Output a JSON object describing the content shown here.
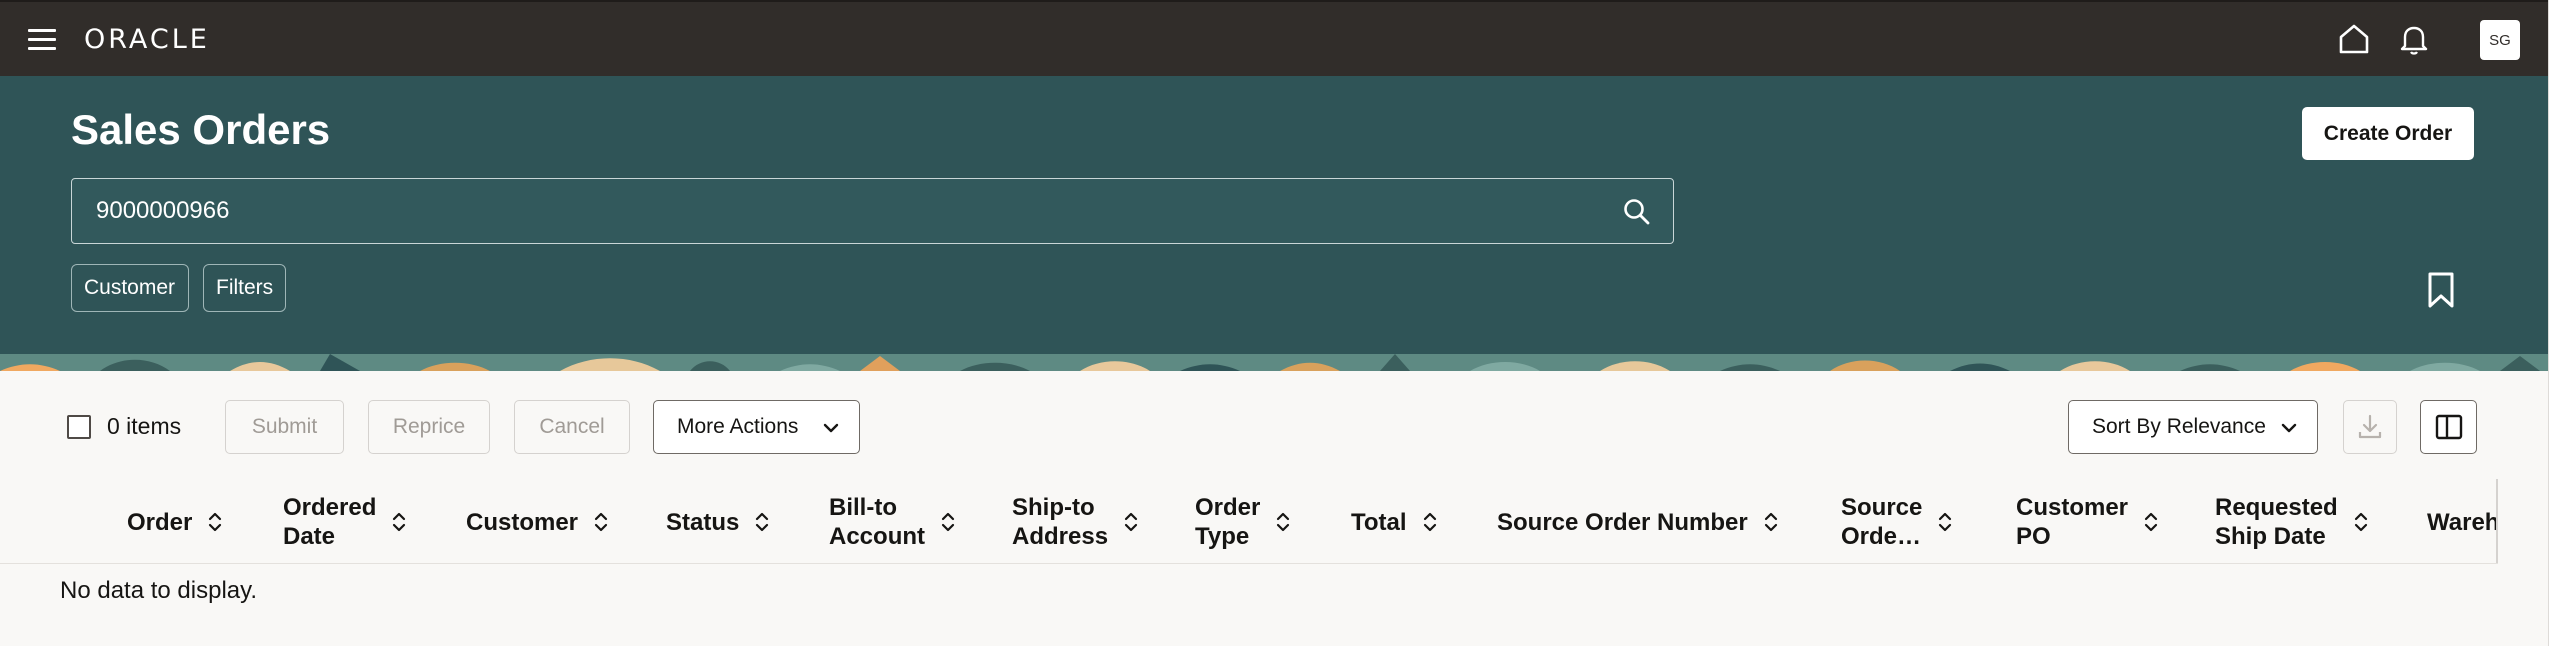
{
  "topbar": {
    "logo": "ORACLE",
    "avatar_initials": "SG"
  },
  "header": {
    "title": "Sales Orders",
    "create_button": "Create Order",
    "search": {
      "value": "9000000966"
    },
    "chips": [
      "Customer",
      "Filters"
    ]
  },
  "toolbar": {
    "items_count": "0 items",
    "submit": "Submit",
    "reprice": "Reprice",
    "cancel": "Cancel",
    "more_actions": "More Actions",
    "sort": "Sort By Relevance"
  },
  "table": {
    "columns": [
      "Order",
      "Ordered\nDate",
      "Customer",
      "Status",
      "Bill-to\nAccount",
      "Ship-to\nAddress",
      "Order\nType",
      "Total",
      "Source Order Number",
      "Source\nOrde…",
      "Customer\nPO",
      "Requested\nShip Date",
      "Wareh"
    ],
    "empty_message": "No data to display."
  },
  "colors": {
    "topbar": "#312d2a",
    "header": "#2f5457",
    "content": "#f9f8f6"
  }
}
